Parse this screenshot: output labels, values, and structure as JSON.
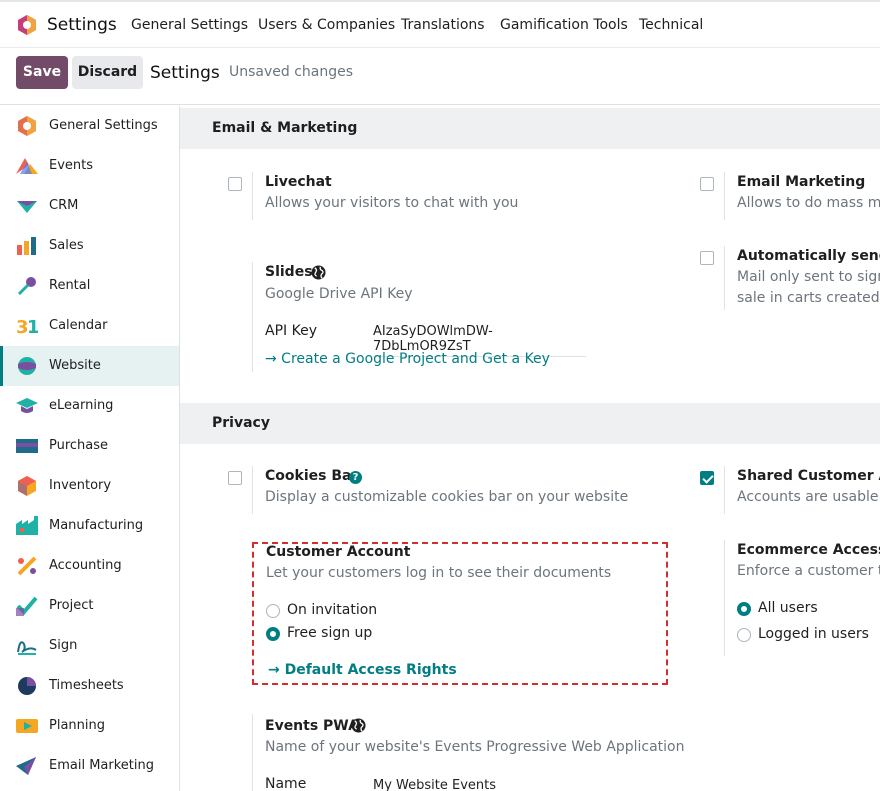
{
  "app": {
    "name": "Settings"
  },
  "topnav": {
    "menu": [
      "General Settings",
      "Users & Companies",
      "Translations",
      "Gamification Tools",
      "Technical"
    ]
  },
  "controlbar": {
    "save_label": "Save",
    "discard_label": "Discard",
    "title": "Settings",
    "status": "Unsaved changes"
  },
  "sidebar": {
    "active": "Website",
    "items": [
      {
        "label": "General Settings",
        "icon": "odoo-logo-icon"
      },
      {
        "label": "Events",
        "icon": "events-icon"
      },
      {
        "label": "CRM",
        "icon": "crm-icon"
      },
      {
        "label": "Sales",
        "icon": "sales-icon"
      },
      {
        "label": "Rental",
        "icon": "rental-icon"
      },
      {
        "label": "Calendar",
        "icon": "calendar-icon"
      },
      {
        "label": "Website",
        "icon": "website-icon"
      },
      {
        "label": "eLearning",
        "icon": "elearning-icon"
      },
      {
        "label": "Purchase",
        "icon": "purchase-icon"
      },
      {
        "label": "Inventory",
        "icon": "inventory-icon"
      },
      {
        "label": "Manufacturing",
        "icon": "manufacturing-icon"
      },
      {
        "label": "Accounting",
        "icon": "accounting-icon"
      },
      {
        "label": "Project",
        "icon": "project-icon"
      },
      {
        "label": "Sign",
        "icon": "sign-icon"
      },
      {
        "label": "Timesheets",
        "icon": "timesheets-icon"
      },
      {
        "label": "Planning",
        "icon": "planning-icon"
      },
      {
        "label": "Email Marketing",
        "icon": "email-marketing-icon"
      }
    ]
  },
  "email_marketing_section": {
    "title": "Email & Marketing",
    "livechat": {
      "title": "Livechat",
      "desc": "Allows your visitors to chat with you",
      "checked": false
    },
    "email_marketing": {
      "title": "Email Marketing",
      "desc": "Allows to do mass mail",
      "checked": false
    },
    "slides": {
      "title": "Slides",
      "desc": "Google Drive API Key",
      "api_key_label": "API Key",
      "api_key_value": "AIzaSyDOWlmDW-7DbLmOR9ZsT",
      "link": "→ Create a Google Project and Get a Key"
    },
    "abandoned": {
      "title": "Automatically send ab",
      "desc_line1": "Mail only sent to signe",
      "desc_line2": "sale in carts created af",
      "checked": false
    }
  },
  "privacy_section": {
    "title": "Privacy",
    "cookies_bar": {
      "title": "Cookies Bar",
      "desc": "Display a customizable cookies bar on your website",
      "checked": false
    },
    "shared_customer": {
      "title": "Shared Customer Acco",
      "desc": "Accounts are usable ac",
      "checked": true
    },
    "customer_account": {
      "title": "Customer Account",
      "desc": "Let your customers log in to see their documents",
      "options": [
        "On invitation",
        "Free sign up"
      ],
      "selected": "Free sign up",
      "link": "→ Default Access Rights"
    },
    "ecommerce_access": {
      "title": "Ecommerce Access",
      "desc": "Enforce a customer to",
      "options": [
        "All users",
        "Logged in users"
      ],
      "selected": "All users"
    },
    "events_pwa": {
      "title": "Events PWA",
      "desc": "Name of your website's Events Progressive Web Application",
      "name_label": "Name",
      "name_value": "My Website Events"
    }
  },
  "colors": {
    "primary": "#714b67",
    "accent": "#017e84",
    "highlight": "#d32f2f"
  }
}
